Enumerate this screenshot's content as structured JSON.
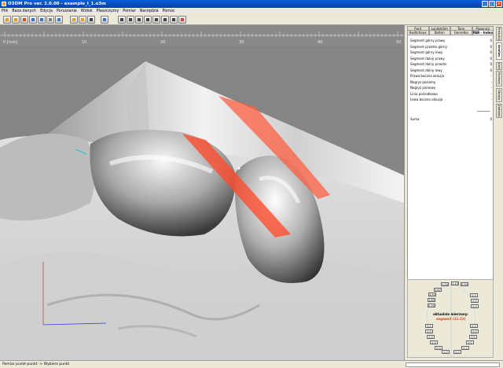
{
  "window": {
    "title": "O3DM Pro ver. 2.0.00 - example_I_1.o3m"
  },
  "menu": [
    "Plik",
    "Baza danych",
    "Edycja",
    "Poruszanie",
    "Widok",
    "Płaszczyzny",
    "Pomiar",
    "Narzędzia",
    "Pomoc"
  ],
  "toolbar_buttons": [
    {
      "name": "open-folder-icon",
      "color": "#e0a020"
    },
    {
      "name": "save-icon",
      "color": "#e0a020"
    },
    {
      "name": "model-icon",
      "color": "#d05020"
    },
    {
      "name": "move-icon",
      "color": "#4070c0"
    },
    {
      "name": "rotate-icon",
      "color": "#4070c0"
    },
    {
      "name": "view-icon",
      "color": "#808080"
    },
    {
      "name": "plane-icon",
      "color": "#4080c0"
    },
    {
      "name": "measure-icon",
      "color": "#e0a020"
    },
    {
      "name": "grid-icon",
      "color": "#e0a020"
    },
    {
      "name": "layer-icon",
      "color": "#404040"
    },
    {
      "name": "select-icon",
      "color": "#4070c0"
    },
    {
      "name": "tool-a-icon",
      "color": "#404040"
    },
    {
      "name": "tool-b-icon",
      "color": "#404040"
    },
    {
      "name": "tool-c-icon",
      "color": "#404040"
    },
    {
      "name": "tool-d-icon",
      "color": "#404040"
    },
    {
      "name": "tool-e-icon",
      "color": "#404040"
    },
    {
      "name": "tool-f-icon",
      "color": "#404040"
    },
    {
      "name": "tool-g-icon",
      "color": "#404040"
    },
    {
      "name": "zoom-icon",
      "color": "#d04040"
    }
  ],
  "panel": {
    "tabs_row1": [
      "Punt",
      "Lundström",
      "Tonn",
      "Pogonicz"
    ],
    "tabs_row2": [
      "Kwiltchaux",
      "Bolton",
      "Gonrelka",
      "PAR - Index"
    ],
    "active_tab": "PAR - Index",
    "rows": [
      {
        "label": "Segment górny prawy",
        "value": "0"
      },
      {
        "label": "Segment przedni górny",
        "value": "0"
      },
      {
        "label": "Segment górny lewy",
        "value": "0"
      },
      {
        "label": "Segment dolny prawy",
        "value": "0"
      },
      {
        "label": "Segment dolny przedni",
        "value": "0"
      },
      {
        "label": "Segment dolny lewy",
        "value": "0"
      },
      {
        "label": "Prawa boczna okluzja",
        "value": "-"
      },
      {
        "label": "Nagryz poziomy",
        "value": "-"
      },
      {
        "label": "Nagryz pionowy",
        "value": "-"
      },
      {
        "label": "Linia pośrodkowa",
        "value": "-"
      },
      {
        "label": "Lewa boczna okluzja",
        "value": "-"
      }
    ],
    "sum": {
      "label": "Suma",
      "value": "0"
    },
    "vertical_tabs": [
      "Predykcja",
      "Analizy",
      "Lista",
      "Pomiary",
      "Obrazy",
      "Zadania"
    ],
    "active_vertical_tab": "Analizy",
    "diagram": {
      "label": "aktualnie mierzony:",
      "segment": "segment (21-22)",
      "upper_values": [
        "1,04",
        "1,43",
        "0,94",
        "1,67",
        "4,90",
        "1,65",
        "0,95"
      ],
      "right_upper_values": [
        "0,0",
        "0,0",
        "0,0"
      ],
      "lower_values": [
        "0,0",
        "0,0",
        "0,0",
        "0,0",
        "0,0",
        "0,0",
        "0,0",
        "0,0",
        "0,0",
        "0,0",
        "0,0",
        "0,0"
      ]
    }
  },
  "viewport": {
    "ruler_ticks": [
      "0 [mm]",
      "10",
      "20",
      "30",
      "40",
      "50"
    ]
  },
  "status": {
    "text": "Pomiar punkt-punkt -> Wybierz punkt"
  }
}
